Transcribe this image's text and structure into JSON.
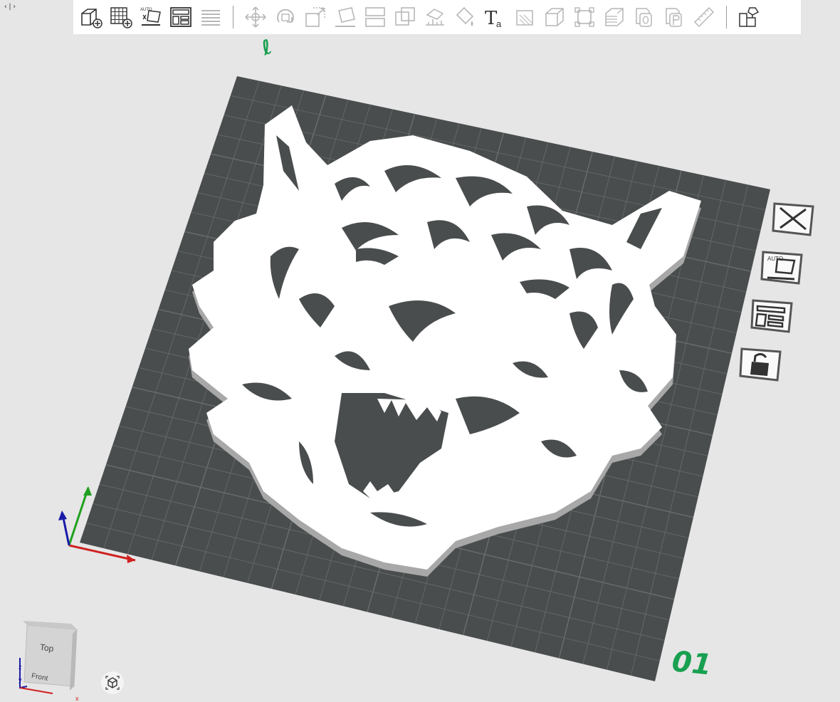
{
  "app": {
    "panel_toggle_glyph": "‹|›"
  },
  "toolbar": {
    "items": [
      {
        "name": "add-part-icon",
        "enabled": true
      },
      {
        "name": "add-plate-icon",
        "enabled": true
      },
      {
        "name": "auto-orient-icon",
        "enabled": true,
        "badge": "AUTO"
      },
      {
        "name": "arrange-icon",
        "enabled": true
      },
      {
        "name": "layers-icon",
        "enabled": false
      },
      {
        "name": "move-icon",
        "enabled": false
      },
      {
        "name": "rotate-icon",
        "enabled": false
      },
      {
        "name": "scale-icon",
        "enabled": false
      },
      {
        "name": "lay-on-face-icon",
        "enabled": false
      },
      {
        "name": "cut-icon",
        "enabled": false
      },
      {
        "name": "boolean-icon",
        "enabled": false
      },
      {
        "name": "support-paint-icon",
        "enabled": false
      },
      {
        "name": "color-paint-icon",
        "enabled": false
      },
      {
        "name": "text-icon",
        "enabled": true
      },
      {
        "name": "seam-paint-icon",
        "enabled": false
      },
      {
        "name": "hollow-icon",
        "enabled": false
      },
      {
        "name": "fit-frame-icon",
        "enabled": false
      },
      {
        "name": "variable-layer-icon",
        "enabled": false
      },
      {
        "name": "copy-icon",
        "enabled": false
      },
      {
        "name": "paste-icon",
        "enabled": false
      },
      {
        "name": "measure-icon",
        "enabled": false
      },
      {
        "name": "assembly-icon",
        "enabled": true
      }
    ],
    "text_tool_glyph": "Ta"
  },
  "plate": {
    "label": "01",
    "edit_mark": "ℓ"
  },
  "plate_controls": [
    {
      "name": "delete-plate-button",
      "icon": "close-icon"
    },
    {
      "name": "orient-plate-button",
      "icon": "auto-orient-icon",
      "badge": "AUTO"
    },
    {
      "name": "arrange-plate-button",
      "icon": "arrange-icon"
    },
    {
      "name": "lock-plate-button",
      "icon": "lock-icon"
    }
  ],
  "view_cube": {
    "top_label": "Top",
    "front_label": "Front",
    "axis_z": "z",
    "axis_y": "y",
    "axis_x": "x"
  },
  "colors": {
    "background": "#e6e6e6",
    "plate": "#4a4d4e",
    "grid": "#6a6d6e",
    "model": "#ffffff",
    "model_side": "#a8a8a8",
    "accent_green": "#18a050",
    "axis_x": "#d02020",
    "axis_y": "#20a020",
    "axis_z": "#1a1aa8"
  }
}
